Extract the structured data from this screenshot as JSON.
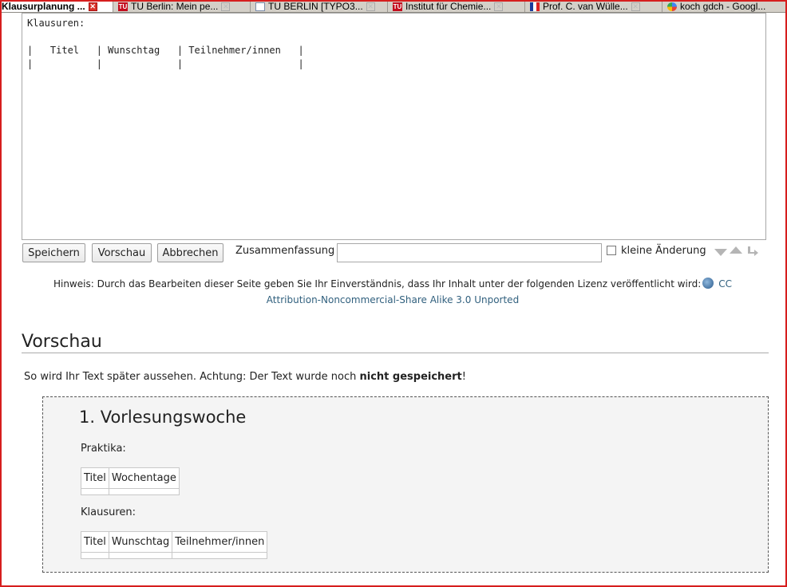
{
  "tabs": [
    {
      "label": "Klausurplanung ...",
      "icon": "wiki-page-icon",
      "active": true
    },
    {
      "label": "TU Berlin: Mein pe...",
      "icon": "tu-logo-icon"
    },
    {
      "label": "TU BERLIN [TYPO3...",
      "icon": "document-icon"
    },
    {
      "label": "Institut für Chemie...",
      "icon": "tu-logo-icon"
    },
    {
      "label": "Prof. C. van Wülle...",
      "icon": "flag-icon"
    },
    {
      "label": "koch gdch - Googl...",
      "icon": "google-icon"
    }
  ],
  "editor": {
    "content": "Klausuren:\n\n|   Titel   | Wunschtag   | Teilnehmer/innen   |\n|           |             |                    |"
  },
  "form": {
    "save_label": "Speichern",
    "preview_label": "Vorschau",
    "cancel_label": "Abbrechen",
    "summary_label": "Zusammenfassung",
    "summary_value": "",
    "minor_edit_label": "kleine Änderung",
    "minor_edit_checked": false
  },
  "notice": {
    "text": "Hinweis: Durch das Bearbeiten dieser Seite geben Sie Ihr Einverständnis, dass Ihr Inhalt unter der folgenden Lizenz veröffentlicht wird:",
    "license_link_cc": "CC",
    "license_link_rest": "Attribution-Noncommercial-Share Alike 3.0 Unported"
  },
  "preview": {
    "heading": "Vorschau",
    "note_prefix": "So wird Ihr Text später aussehen. Achtung: Der Text wurde noch ",
    "note_bold": "nicht gespeichert",
    "note_suffix": "!",
    "week_heading": "1. Vorlesungswoche",
    "praktika_label": "Praktika:",
    "praktika_headers": [
      "Titel",
      "Wochentage"
    ],
    "klausuren_label": "Klausuren:",
    "klausuren_headers": [
      "Titel",
      "Wunschtag",
      "Teilnehmer/innen"
    ]
  },
  "colors": {
    "frame": "#d61e1e",
    "link": "#31607e",
    "preview_bg": "#f4f4f4"
  }
}
